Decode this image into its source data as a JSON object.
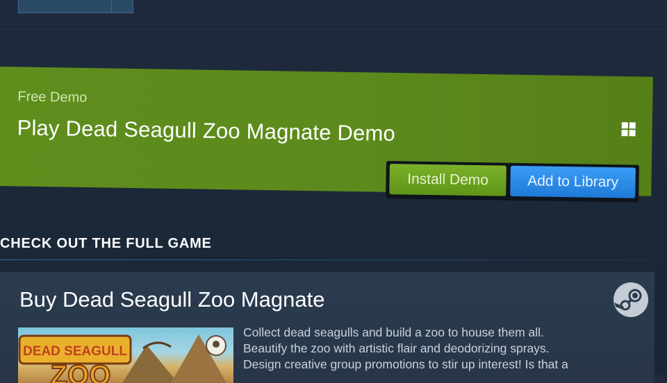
{
  "demo": {
    "label": "Free Demo",
    "title": "Play Dead Seagull Zoo Magnate Demo",
    "platform_icon": "windows-icon",
    "install_label": "Install Demo",
    "library_label": "Add to Library"
  },
  "section": {
    "heading": "CHECK OUT THE FULL GAME"
  },
  "buy": {
    "title": "Buy Dead Seagull Zoo Magnate",
    "capsule": {
      "logo_line1": "DEAD SEAGULL",
      "logo_line2": "ZOO"
    },
    "description": [
      "Collect dead seagulls and build a zoo to house them all.",
      "Beautify the zoo with artistic flair and deodorizing sprays.",
      "Design creative group promotions to stir up interest! Is that a"
    ],
    "icon": "steam-icon"
  },
  "colors": {
    "demo_green": "#5c8a1c",
    "install_green": "#6ea223",
    "library_blue": "#2a8ae6",
    "panel_dark": "#2a3a4e",
    "page_bg": "#1b2838"
  }
}
